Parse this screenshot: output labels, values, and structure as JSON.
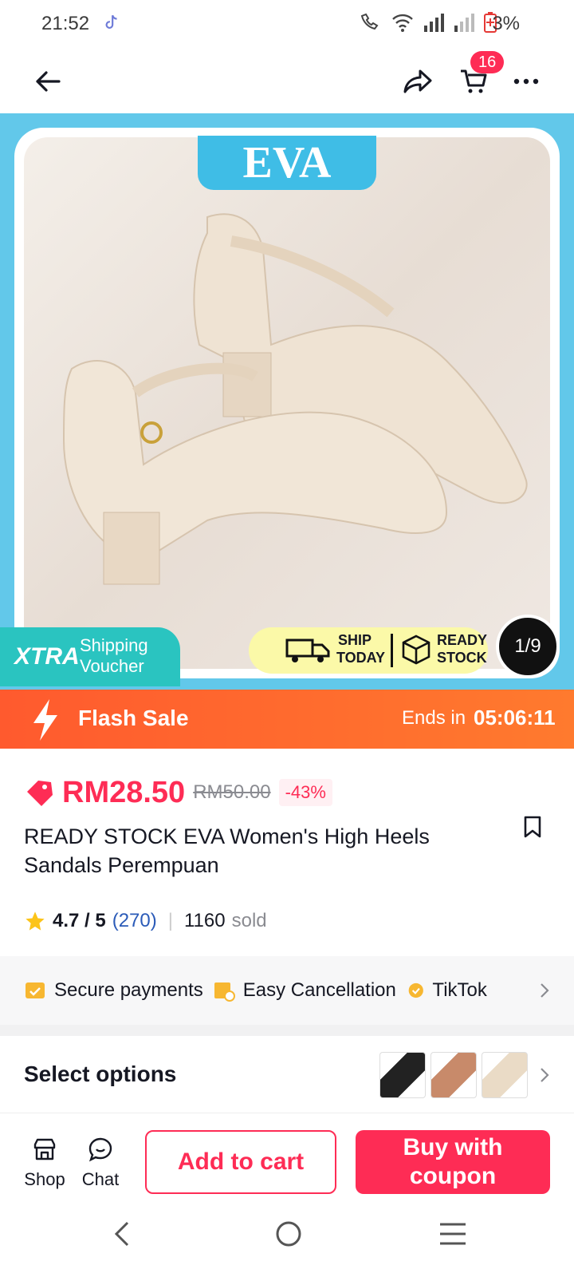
{
  "status_bar": {
    "time": "21:52",
    "battery": "3%"
  },
  "header": {
    "cart_count": "16"
  },
  "hero": {
    "brand_banner": "EVA",
    "xtra_label": "XTRA",
    "xtra_text_1": "Shipping",
    "xtra_text_2": "Voucher",
    "ship_1": "SHIP",
    "ship_2": "TODAY",
    "ready_1": "READY",
    "ready_2": "STOCK",
    "image_counter": "1/9"
  },
  "flash_sale": {
    "label": "Flash Sale",
    "ends_label": "Ends in",
    "countdown": "05:06:11"
  },
  "product": {
    "price": "RM28.50",
    "original_price": "RM50.00",
    "discount": "-43%",
    "title": "READY STOCK EVA Women's High Heels Sandals Perempuan",
    "rating": "4.7 / 5",
    "review_count": "(270)",
    "sold_count": "1160",
    "sold_label": "sold"
  },
  "features": [
    "Secure payments",
    "Easy Cancellation",
    "TikTok"
  ],
  "options": {
    "label": "Select options"
  },
  "bottom_bar": {
    "shop": "Shop",
    "chat": "Chat",
    "add_to_cart": "Add to cart",
    "buy_line1": "Buy with",
    "buy_line2": "coupon"
  },
  "colors": {
    "accent": "#fe2c55",
    "flash": "#ff6a2e",
    "hero_bg": "#62c8ea",
    "xtra": "#2ac4c0"
  }
}
